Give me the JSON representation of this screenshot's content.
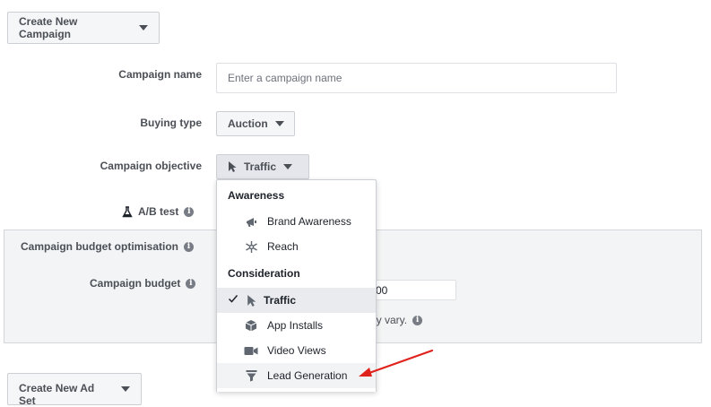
{
  "toolbar": {
    "create_campaign_label": "Create New Campaign"
  },
  "form": {
    "campaign_name": {
      "label": "Campaign name",
      "placeholder": "Enter a campaign name",
      "value": ""
    },
    "buying_type": {
      "label": "Buying type",
      "value": "Auction"
    },
    "campaign_objective": {
      "label": "Campaign objective",
      "value": "Traffic"
    },
    "ab_test": {
      "label": "A/B test"
    }
  },
  "budget_panel": {
    "optimisation_label": "Campaign budget optimisation",
    "budget_label": "Campaign budget",
    "budget_value_visible": "00",
    "hint_partial": "ay vary."
  },
  "objective_menu": {
    "groups": [
      {
        "heading": "Awareness",
        "items": [
          {
            "label": "Brand Awareness",
            "icon": "megaphone-icon"
          },
          {
            "label": "Reach",
            "icon": "reach-icon"
          }
        ]
      },
      {
        "heading": "Consideration",
        "items": [
          {
            "label": "Traffic",
            "icon": "cursor-icon",
            "selected": true
          },
          {
            "label": "App Installs",
            "icon": "box-icon"
          },
          {
            "label": "Video Views",
            "icon": "video-camera-icon"
          },
          {
            "label": "Lead Generation",
            "icon": "funnel-icon"
          }
        ]
      }
    ]
  },
  "ad_set": {
    "create_label": "Create New Ad Set"
  },
  "colors": {
    "accent": "#4267b2",
    "arrow": "#e0221c",
    "panel_bg": "#f2f4f5"
  }
}
